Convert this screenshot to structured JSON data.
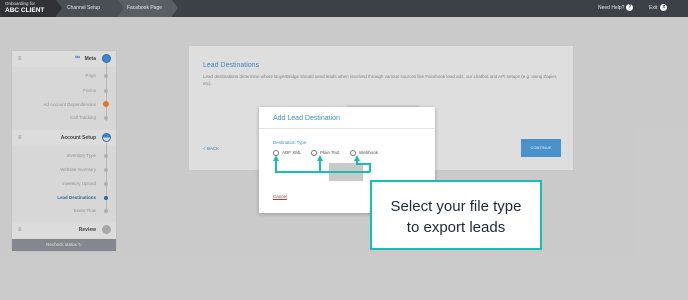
{
  "topbar": {
    "onboarding_label": "Onboarding for",
    "client_name": "ABC CLIENT",
    "crumb_1": "Channel Setup",
    "crumb_2": "Facebook Page",
    "need_help": "Need Help?",
    "help_glyph": "?",
    "exit": "Exit",
    "exit_glyph": "x"
  },
  "sidebar": {
    "meta": {
      "logo": "∞",
      "title": "Meta",
      "steps": [
        "Page",
        "Forms",
        "Ad Account Dependencies",
        "Call Tracking"
      ]
    },
    "account_setup": {
      "title": "Account Setup",
      "steps": [
        "Inventory Type",
        "Website Inventory",
        "Inventory Upload",
        "Lead Destinations",
        "Event Flow"
      ]
    },
    "review": {
      "title": "Review"
    },
    "recheck": "Recheck status",
    "recheck_icon": "↻"
  },
  "card": {
    "title": "Lead Destinations",
    "description": "Lead destinations determine where BuyerBridge should send leads when received through various sources like Facebook lead ads, our chatbot and API setups (e.g. using Zapier, etc).",
    "back": "< BACK",
    "continue": "CONTINUE"
  },
  "modal": {
    "title": "Add Lead Destination",
    "field_label": "Destination Type",
    "options": [
      "ADF XML",
      "Plain Text",
      "Webhook"
    ],
    "cancel": "Cancel"
  },
  "callout": {
    "line1": "Select your file type",
    "line2": "to export leads"
  },
  "colors": {
    "accent": "#3a8fd6",
    "callout_border": "#16c0b1",
    "annotation_arrow": "#16c0b1",
    "warning": "#f07c29",
    "topbar": "#3c4147"
  }
}
